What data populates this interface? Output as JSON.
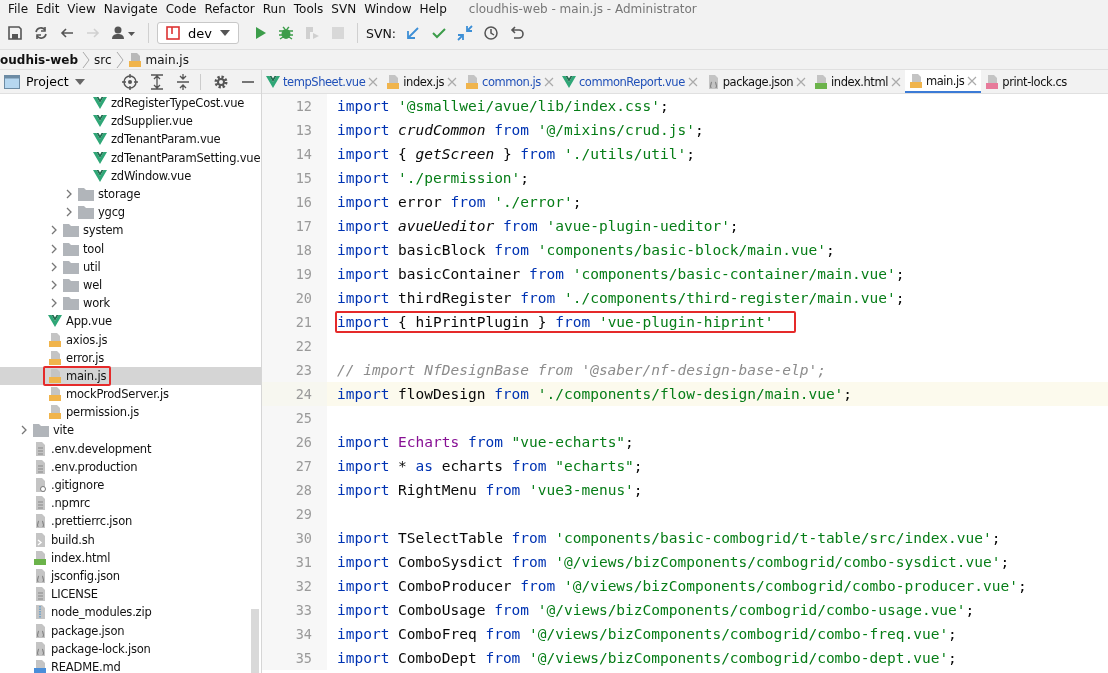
{
  "window": {
    "title": "cloudhis-web - main.js - Administrator"
  },
  "menu": [
    "File",
    "Edit",
    "View",
    "Navigate",
    "Code",
    "Refactor",
    "Run",
    "Tools",
    "SVN",
    "Window",
    "Help"
  ],
  "toolbar": {
    "left": [
      {
        "kind": "save",
        "disabled": false
      },
      {
        "kind": "sync",
        "disabled": false
      },
      {
        "kind": "back",
        "disabled": false
      },
      {
        "kind": "forward",
        "disabled": true
      },
      {
        "kind": "user",
        "disabled": false
      }
    ],
    "run_config": "dev",
    "run": [
      {
        "kind": "run",
        "disabled": false
      },
      {
        "kind": "debug",
        "disabled": false
      },
      {
        "kind": "coverage",
        "disabled": true
      },
      {
        "kind": "stop",
        "disabled": true
      }
    ],
    "svn_label": "SVN:",
    "svn": [
      {
        "kind": "update",
        "disabled": false
      },
      {
        "kind": "commit",
        "disabled": false
      },
      {
        "kind": "compare",
        "disabled": false
      },
      {
        "kind": "history",
        "disabled": false
      },
      {
        "kind": "revert",
        "disabled": false
      }
    ]
  },
  "breadcrumb": [
    {
      "label": "oudhis-web",
      "kind": "project"
    },
    {
      "label": "src",
      "kind": "folder"
    },
    {
      "label": "main.js",
      "kind": "js"
    }
  ],
  "project_panel": {
    "title": "Project",
    "tree": [
      {
        "children": [
          {
            "children": [
              {
                "children": [
                  {
                    "children": [
                      {
                        "label": "zdRegisterTypeCost.vue",
                        "kind": "vue"
                      },
                      {
                        "label": "zdSupplier.vue",
                        "kind": "vue"
                      },
                      {
                        "label": "zdTenantParam.vue",
                        "kind": "vue"
                      },
                      {
                        "label": "zdTenantParamSetting.vue",
                        "kind": "vue"
                      },
                      {
                        "label": "zdWindow.vue",
                        "kind": "vue"
                      }
                    ]
                  },
                  {
                    "label": "storage",
                    "kind": "folder",
                    "expanded": false
                  },
                  {
                    "label": "ygcg",
                    "kind": "folder",
                    "expanded": false
                  }
                ]
              },
              {
                "label": "system",
                "kind": "folder",
                "expanded": false
              },
              {
                "label": "tool",
                "kind": "folder",
                "expanded": false
              },
              {
                "label": "util",
                "kind": "folder",
                "expanded": false
              },
              {
                "label": "wel",
                "kind": "folder",
                "expanded": false
              },
              {
                "label": "work",
                "kind": "folder",
                "expanded": false
              }
            ]
          },
          {
            "label": "App.vue",
            "kind": "vue"
          },
          {
            "label": "axios.js",
            "kind": "js"
          },
          {
            "label": "error.js",
            "kind": "js"
          },
          {
            "label": "main.js",
            "kind": "js",
            "selected": true,
            "highlighted": true
          },
          {
            "label": "mockProdServer.js",
            "kind": "js"
          },
          {
            "label": "permission.js",
            "kind": "js"
          }
        ]
      },
      {
        "label": "vite",
        "kind": "folder",
        "expanded": false
      },
      {
        "label": ".env.development",
        "kind": "text"
      },
      {
        "label": ".env.production",
        "kind": "text"
      },
      {
        "label": ".gitignore",
        "kind": "ignore"
      },
      {
        "label": ".npmrc",
        "kind": "text"
      },
      {
        "label": ".prettierrc.json",
        "kind": "json"
      },
      {
        "label": "build.sh",
        "kind": "shell"
      },
      {
        "label": "index.html",
        "kind": "html"
      },
      {
        "label": "jsconfig.json",
        "kind": "json"
      },
      {
        "label": "LICENSE",
        "kind": "text"
      },
      {
        "label": "node_modules.zip",
        "kind": "zip"
      },
      {
        "label": "package.json",
        "kind": "json"
      },
      {
        "label": "package-lock.json",
        "kind": "json"
      },
      {
        "label": "README.md",
        "kind": "md"
      }
    ]
  },
  "tabs": [
    {
      "label": "tempSheet.vue",
      "kind": "vue",
      "modified": true,
      "selected": false
    },
    {
      "label": "index.js",
      "kind": "js",
      "modified": false,
      "selected": false
    },
    {
      "label": "common.js",
      "kind": "js",
      "modified": true,
      "selected": false
    },
    {
      "label": "commonReport.vue",
      "kind": "vue",
      "modified": true,
      "selected": false
    },
    {
      "label": "package.json",
      "kind": "json",
      "modified": false,
      "selected": false
    },
    {
      "label": "index.html",
      "kind": "html",
      "modified": false,
      "selected": false
    },
    {
      "label": "main.js",
      "kind": "js",
      "modified": false,
      "selected": true
    },
    {
      "label": "print-lock.cs",
      "kind": "css",
      "modified": false,
      "selected": false
    }
  ],
  "editor": {
    "lines": [
      {
        "number": "12",
        "tokens": [
          {
            "kind": "kw",
            "text": "import "
          },
          {
            "kind": "str",
            "text": "'@smallwei/avue/lib/index.css'"
          },
          {
            "kind": "id",
            "text": ";"
          }
        ]
      },
      {
        "number": "13",
        "tokens": [
          {
            "kind": "kw",
            "text": "import "
          },
          {
            "kind": "it",
            "text": "crudCommon "
          },
          {
            "kind": "kw",
            "text": "from "
          },
          {
            "kind": "str",
            "text": "'@/mixins/crud.js'"
          },
          {
            "kind": "id",
            "text": ";"
          }
        ]
      },
      {
        "number": "14",
        "tokens": [
          {
            "kind": "kw",
            "text": "import "
          },
          {
            "kind": "id",
            "text": "{ "
          },
          {
            "kind": "it",
            "text": "getScreen "
          },
          {
            "kind": "id",
            "text": "} "
          },
          {
            "kind": "kw",
            "text": "from "
          },
          {
            "kind": "str",
            "text": "'./utils/util'"
          },
          {
            "kind": "id",
            "text": ";"
          }
        ]
      },
      {
        "number": "15",
        "tokens": [
          {
            "kind": "kw",
            "text": "import "
          },
          {
            "kind": "str",
            "text": "'./permission'"
          },
          {
            "kind": "id",
            "text": ";"
          }
        ]
      },
      {
        "number": "16",
        "tokens": [
          {
            "kind": "kw",
            "text": "import "
          },
          {
            "kind": "id",
            "text": "error "
          },
          {
            "kind": "kw",
            "text": "from "
          },
          {
            "kind": "str",
            "text": "'./error'"
          },
          {
            "kind": "id",
            "text": ";"
          }
        ]
      },
      {
        "number": "17",
        "tokens": [
          {
            "kind": "kw",
            "text": "import "
          },
          {
            "kind": "it",
            "text": "avueUeditor "
          },
          {
            "kind": "kw",
            "text": "from "
          },
          {
            "kind": "str",
            "text": "'avue-plugin-ueditor'"
          },
          {
            "kind": "id",
            "text": ";"
          }
        ]
      },
      {
        "number": "18",
        "tokens": [
          {
            "kind": "kw",
            "text": "import "
          },
          {
            "kind": "id",
            "text": "basicBlock "
          },
          {
            "kind": "kw",
            "text": "from "
          },
          {
            "kind": "str",
            "text": "'components/basic-block/main.vue'"
          },
          {
            "kind": "id",
            "text": ";"
          }
        ]
      },
      {
        "number": "19",
        "tokens": [
          {
            "kind": "kw",
            "text": "import "
          },
          {
            "kind": "id",
            "text": "basicContainer "
          },
          {
            "kind": "kw",
            "text": "from "
          },
          {
            "kind": "str",
            "text": "'components/basic-container/main.vue'"
          },
          {
            "kind": "id",
            "text": ";"
          }
        ]
      },
      {
        "number": "20",
        "tokens": [
          {
            "kind": "kw",
            "text": "import "
          },
          {
            "kind": "id",
            "text": "thirdRegister "
          },
          {
            "kind": "kw",
            "text": "from "
          },
          {
            "kind": "str",
            "text": "'./components/third-register/main.vue'"
          },
          {
            "kind": "id",
            "text": ";"
          }
        ]
      },
      {
        "number": "21",
        "highlighted": true,
        "tokens": [
          {
            "kind": "kw",
            "text": "import "
          },
          {
            "kind": "id",
            "text": "{ hiPrintPlugin } "
          },
          {
            "kind": "kw",
            "text": "from "
          },
          {
            "kind": "str",
            "text": "'vue-plugin-hiprint'"
          }
        ]
      },
      {
        "number": "22"
      },
      {
        "number": "23",
        "tokens": [
          {
            "kind": "cmt",
            "text": "// import NfDesignBase from '@saber/nf-design-base-elp';"
          }
        ]
      },
      {
        "number": "24",
        "current": true,
        "tokens": [
          {
            "kind": "kw",
            "text": "import "
          },
          {
            "kind": "id",
            "text": "flowDesign "
          },
          {
            "kind": "kw",
            "text": "from "
          },
          {
            "kind": "str",
            "text": "'./components/flow-design/main.vue'"
          },
          {
            "kind": "id",
            "text": ";"
          }
        ]
      },
      {
        "number": "25"
      },
      {
        "number": "26",
        "tokens": [
          {
            "kind": "kw",
            "text": "import "
          },
          {
            "kind": "pur",
            "text": "Echarts "
          },
          {
            "kind": "kw",
            "text": "from "
          },
          {
            "kind": "str",
            "text": "\"vue-echarts\""
          },
          {
            "kind": "id",
            "text": ";"
          }
        ]
      },
      {
        "number": "27",
        "tokens": [
          {
            "kind": "kw",
            "text": "import "
          },
          {
            "kind": "id",
            "text": "* "
          },
          {
            "kind": "kw",
            "text": "as "
          },
          {
            "kind": "id",
            "text": "echarts "
          },
          {
            "kind": "kw",
            "text": "from "
          },
          {
            "kind": "str",
            "text": "\"echarts\""
          },
          {
            "kind": "id",
            "text": ";"
          }
        ]
      },
      {
        "number": "28",
        "tokens": [
          {
            "kind": "kw",
            "text": "import "
          },
          {
            "kind": "id",
            "text": "RightMenu "
          },
          {
            "kind": "kw",
            "text": "from "
          },
          {
            "kind": "str",
            "text": "'vue3-menus'"
          },
          {
            "kind": "id",
            "text": ";"
          }
        ]
      },
      {
        "number": "29"
      },
      {
        "number": "30",
        "tokens": [
          {
            "kind": "kw",
            "text": "import "
          },
          {
            "kind": "id",
            "text": "TSelectTable "
          },
          {
            "kind": "kw",
            "text": "from "
          },
          {
            "kind": "str",
            "text": "'components/basic-combogrid/t-table/src/index.vue'"
          },
          {
            "kind": "id",
            "text": ";"
          }
        ]
      },
      {
        "number": "31",
        "tokens": [
          {
            "kind": "kw",
            "text": "import "
          },
          {
            "kind": "id",
            "text": "ComboSysdict "
          },
          {
            "kind": "kw",
            "text": "from "
          },
          {
            "kind": "str",
            "text": "'@/views/bizComponents/combogrid/combo-sysdict.vue'"
          },
          {
            "kind": "id",
            "text": ";"
          }
        ]
      },
      {
        "number": "32",
        "tokens": [
          {
            "kind": "kw",
            "text": "import "
          },
          {
            "kind": "id",
            "text": "ComboProducer "
          },
          {
            "kind": "kw",
            "text": "from "
          },
          {
            "kind": "str",
            "text": "'@/views/bizComponents/combogrid/combo-producer.vue'"
          },
          {
            "kind": "id",
            "text": ";"
          }
        ]
      },
      {
        "number": "33",
        "tokens": [
          {
            "kind": "kw",
            "text": "import "
          },
          {
            "kind": "id",
            "text": "ComboUsage "
          },
          {
            "kind": "kw",
            "text": "from "
          },
          {
            "kind": "str",
            "text": "'@/views/bizComponents/combogrid/combo-usage.vue'"
          },
          {
            "kind": "id",
            "text": ";"
          }
        ]
      },
      {
        "number": "34",
        "tokens": [
          {
            "kind": "kw",
            "text": "import "
          },
          {
            "kind": "id",
            "text": "ComboFreq "
          },
          {
            "kind": "kw",
            "text": "from "
          },
          {
            "kind": "str",
            "text": "'@/views/bizComponents/combogrid/combo-freq.vue'"
          },
          {
            "kind": "id",
            "text": ";"
          }
        ]
      },
      {
        "number": "35",
        "tokens": [
          {
            "kind": "kw",
            "text": "import "
          },
          {
            "kind": "id",
            "text": "ComboDept "
          },
          {
            "kind": "kw",
            "text": "from "
          },
          {
            "kind": "str",
            "text": "'@/views/bizComponents/combogrid/combo-dept.vue'"
          },
          {
            "kind": "id",
            "text": ";"
          }
        ]
      }
    ]
  }
}
